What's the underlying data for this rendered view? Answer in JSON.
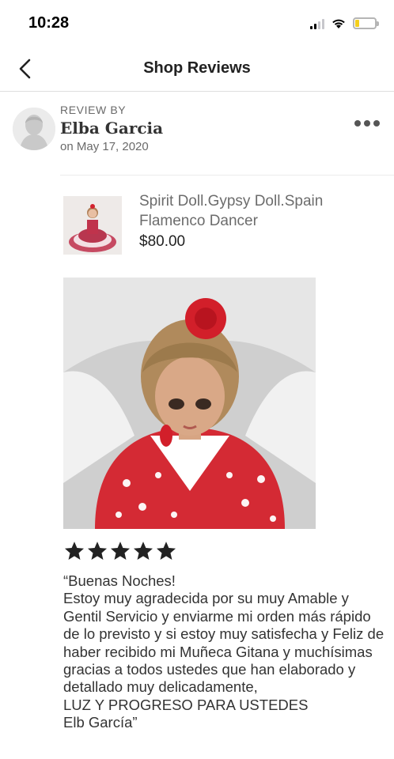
{
  "status_bar": {
    "time": "10:28",
    "battery_color": "#f4cf1c"
  },
  "nav": {
    "back_icon": "chevron-left-icon",
    "title": "Shop Reviews"
  },
  "review": {
    "review_by_label": "REVIEW BY",
    "reviewer_name": "Elba Garcia",
    "date": "on May 17, 2020",
    "more_icon": "more-horizontal-icon",
    "rating": 5,
    "rating_max": 5,
    "text": "“Buenas Noches!\nEstoy muy agradecida por su muy Amable y Gentil Servicio y enviarme mi orden más rápido de lo previsto y si estoy muy satisfecha y Feliz de haber recibido mi Muñeca Gitana y muchísimas gracias a todos ustedes que han elaborado y detallado muy delicadamente,\nLUZ Y PROGRESO PARA USTEDES\nElb García”"
  },
  "listing": {
    "title": "Spirit Doll.Gypsy Doll.Spain Flamenco Dancer",
    "price": "$80.00"
  },
  "colors": {
    "star": "#222222",
    "divider": "#dedede"
  }
}
